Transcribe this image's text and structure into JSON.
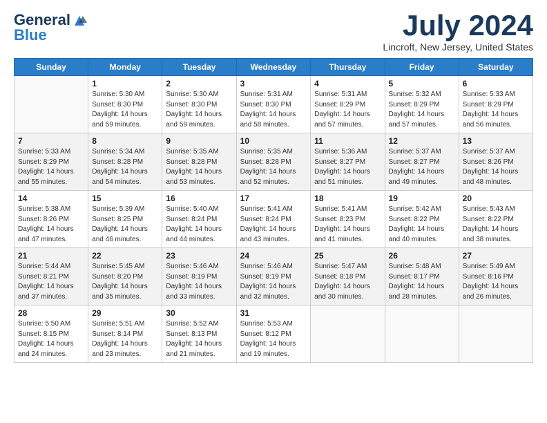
{
  "logo": {
    "general": "General",
    "blue": "Blue"
  },
  "title": "July 2024",
  "location": "Lincroft, New Jersey, United States",
  "days_of_week": [
    "Sunday",
    "Monday",
    "Tuesday",
    "Wednesday",
    "Thursday",
    "Friday",
    "Saturday"
  ],
  "weeks": [
    [
      {
        "day": "",
        "info": ""
      },
      {
        "day": "1",
        "info": "Sunrise: 5:30 AM\nSunset: 8:30 PM\nDaylight: 14 hours\nand 59 minutes."
      },
      {
        "day": "2",
        "info": "Sunrise: 5:30 AM\nSunset: 8:30 PM\nDaylight: 14 hours\nand 59 minutes."
      },
      {
        "day": "3",
        "info": "Sunrise: 5:31 AM\nSunset: 8:30 PM\nDaylight: 14 hours\nand 58 minutes."
      },
      {
        "day": "4",
        "info": "Sunrise: 5:31 AM\nSunset: 8:29 PM\nDaylight: 14 hours\nand 57 minutes."
      },
      {
        "day": "5",
        "info": "Sunrise: 5:32 AM\nSunset: 8:29 PM\nDaylight: 14 hours\nand 57 minutes."
      },
      {
        "day": "6",
        "info": "Sunrise: 5:33 AM\nSunset: 8:29 PM\nDaylight: 14 hours\nand 56 minutes."
      }
    ],
    [
      {
        "day": "7",
        "info": "Sunrise: 5:33 AM\nSunset: 8:29 PM\nDaylight: 14 hours\nand 55 minutes."
      },
      {
        "day": "8",
        "info": "Sunrise: 5:34 AM\nSunset: 8:28 PM\nDaylight: 14 hours\nand 54 minutes."
      },
      {
        "day": "9",
        "info": "Sunrise: 5:35 AM\nSunset: 8:28 PM\nDaylight: 14 hours\nand 53 minutes."
      },
      {
        "day": "10",
        "info": "Sunrise: 5:35 AM\nSunset: 8:28 PM\nDaylight: 14 hours\nand 52 minutes."
      },
      {
        "day": "11",
        "info": "Sunrise: 5:36 AM\nSunset: 8:27 PM\nDaylight: 14 hours\nand 51 minutes."
      },
      {
        "day": "12",
        "info": "Sunrise: 5:37 AM\nSunset: 8:27 PM\nDaylight: 14 hours\nand 49 minutes."
      },
      {
        "day": "13",
        "info": "Sunrise: 5:37 AM\nSunset: 8:26 PM\nDaylight: 14 hours\nand 48 minutes."
      }
    ],
    [
      {
        "day": "14",
        "info": "Sunrise: 5:38 AM\nSunset: 8:26 PM\nDaylight: 14 hours\nand 47 minutes."
      },
      {
        "day": "15",
        "info": "Sunrise: 5:39 AM\nSunset: 8:25 PM\nDaylight: 14 hours\nand 46 minutes."
      },
      {
        "day": "16",
        "info": "Sunrise: 5:40 AM\nSunset: 8:24 PM\nDaylight: 14 hours\nand 44 minutes."
      },
      {
        "day": "17",
        "info": "Sunrise: 5:41 AM\nSunset: 8:24 PM\nDaylight: 14 hours\nand 43 minutes."
      },
      {
        "day": "18",
        "info": "Sunrise: 5:41 AM\nSunset: 8:23 PM\nDaylight: 14 hours\nand 41 minutes."
      },
      {
        "day": "19",
        "info": "Sunrise: 5:42 AM\nSunset: 8:22 PM\nDaylight: 14 hours\nand 40 minutes."
      },
      {
        "day": "20",
        "info": "Sunrise: 5:43 AM\nSunset: 8:22 PM\nDaylight: 14 hours\nand 38 minutes."
      }
    ],
    [
      {
        "day": "21",
        "info": "Sunrise: 5:44 AM\nSunset: 8:21 PM\nDaylight: 14 hours\nand 37 minutes."
      },
      {
        "day": "22",
        "info": "Sunrise: 5:45 AM\nSunset: 8:20 PM\nDaylight: 14 hours\nand 35 minutes."
      },
      {
        "day": "23",
        "info": "Sunrise: 5:46 AM\nSunset: 8:19 PM\nDaylight: 14 hours\nand 33 minutes."
      },
      {
        "day": "24",
        "info": "Sunrise: 5:46 AM\nSunset: 8:19 PM\nDaylight: 14 hours\nand 32 minutes."
      },
      {
        "day": "25",
        "info": "Sunrise: 5:47 AM\nSunset: 8:18 PM\nDaylight: 14 hours\nand 30 minutes."
      },
      {
        "day": "26",
        "info": "Sunrise: 5:48 AM\nSunset: 8:17 PM\nDaylight: 14 hours\nand 28 minutes."
      },
      {
        "day": "27",
        "info": "Sunrise: 5:49 AM\nSunset: 8:16 PM\nDaylight: 14 hours\nand 26 minutes."
      }
    ],
    [
      {
        "day": "28",
        "info": "Sunrise: 5:50 AM\nSunset: 8:15 PM\nDaylight: 14 hours\nand 24 minutes."
      },
      {
        "day": "29",
        "info": "Sunrise: 5:51 AM\nSunset: 8:14 PM\nDaylight: 14 hours\nand 23 minutes."
      },
      {
        "day": "30",
        "info": "Sunrise: 5:52 AM\nSunset: 8:13 PM\nDaylight: 14 hours\nand 21 minutes."
      },
      {
        "day": "31",
        "info": "Sunrise: 5:53 AM\nSunset: 8:12 PM\nDaylight: 14 hours\nand 19 minutes."
      },
      {
        "day": "",
        "info": ""
      },
      {
        "day": "",
        "info": ""
      },
      {
        "day": "",
        "info": ""
      }
    ]
  ]
}
